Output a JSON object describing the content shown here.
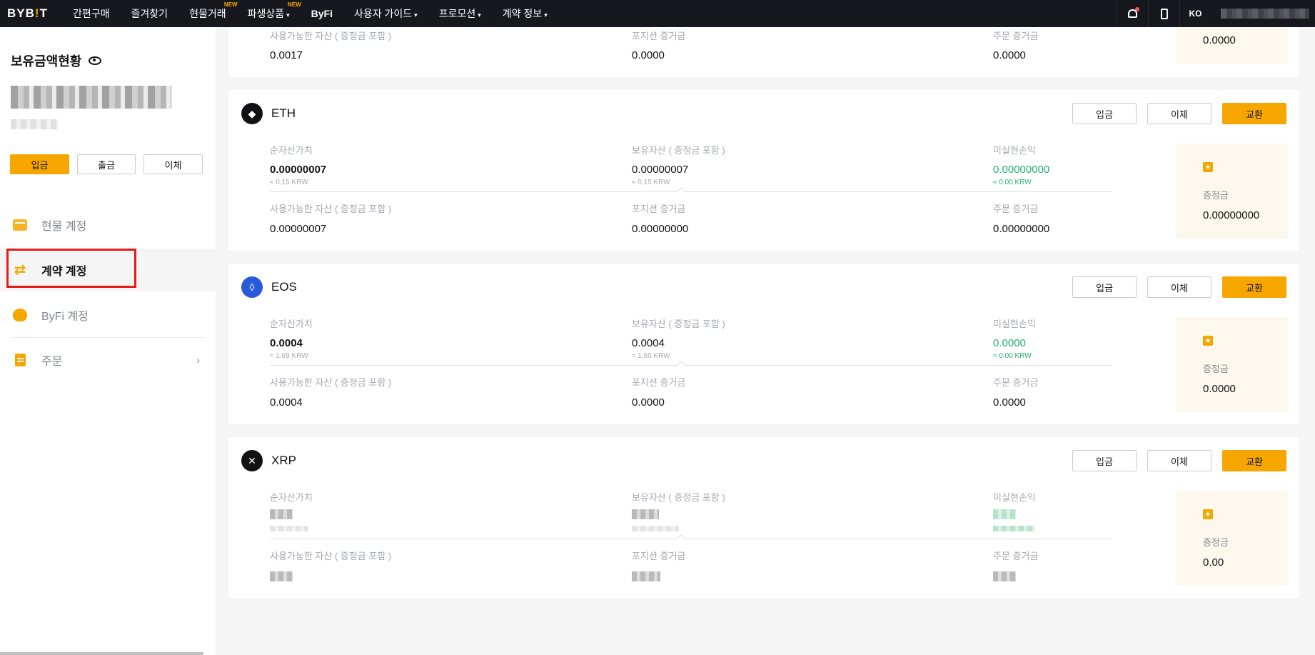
{
  "nav": {
    "logo_a": "BYB",
    "logo_b": "!",
    "logo_c": "T",
    "items": [
      {
        "label": "간편구매"
      },
      {
        "label": "즐겨찾기"
      },
      {
        "label": "현물거래",
        "badge": "NEW"
      },
      {
        "label": "파생상품",
        "badge": "NEW",
        "caret": "▾"
      },
      {
        "label": "ByFi"
      },
      {
        "label": "사용자 가이드",
        "caret": "▾"
      },
      {
        "label": "프로모션",
        "caret": "▾"
      },
      {
        "label": "계약 정보",
        "caret": "▾"
      }
    ],
    "lang": "KO"
  },
  "sidebar": {
    "title": "보유금액현황",
    "buttons": {
      "deposit": "입금",
      "withdraw": "출금",
      "transfer": "이체"
    },
    "items": [
      {
        "label": "현물 계정",
        "icon": "wallet-icon"
      },
      {
        "label": "계약 계정",
        "icon": "swap-icon"
      },
      {
        "label": "ByFi 계정",
        "icon": "piggy-bank-icon"
      },
      {
        "label": "주문",
        "icon": "clipboard-icon",
        "chevron": "›"
      }
    ]
  },
  "labels": {
    "equity": "순자산가치",
    "wallet_balance": "보유자산 ( 증정금 포함 )",
    "unrealized_pnl": "미실현손익",
    "available": "사용가능한 자산 ( 증정금 포함 )",
    "position_margin": "포지션 증거금",
    "order_margin": "주문 증거금",
    "bonus": "증정금",
    "btn_deposit": "입금",
    "btn_transfer": "이체",
    "btn_swap": "교환"
  },
  "top_card": {
    "available": "0.0017",
    "position_margin": "0.0000",
    "order_margin": "0.0000",
    "bonus": "0.0000"
  },
  "coins": [
    {
      "name": "ETH",
      "icon_color": "#121214",
      "equity": "0.00000007",
      "equity_krw": "≈ 0.15 KRW",
      "wallet_balance": "0.00000007",
      "wallet_krw": "≈ 0.15 KRW",
      "unrealized_pnl": "0.00000000",
      "pnl_krw": "≈ 0.00 KRW",
      "available": "0.00000007",
      "position_margin": "0.00000000",
      "order_margin": "0.00000000",
      "bonus": "0.00000000"
    },
    {
      "name": "EOS",
      "icon_color": "#2a5ada",
      "equity": "0.0004",
      "equity_krw": "≈ 1.69 KRW",
      "wallet_balance": "0.0004",
      "wallet_krw": "≈ 1.69 KRW",
      "unrealized_pnl": "0.0000",
      "pnl_krw": "≈ 0.00 KRW",
      "available": "0.0004",
      "position_margin": "0.0000",
      "order_margin": "0.0000",
      "bonus": "0.0000"
    },
    {
      "name": "XRP",
      "icon_color": "#121214",
      "bonus": "0.00"
    }
  ]
}
